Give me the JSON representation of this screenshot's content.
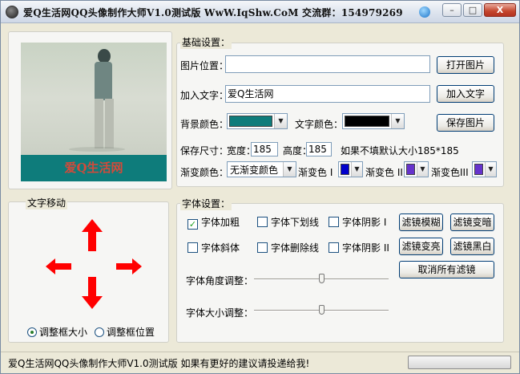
{
  "window": {
    "title": "爱Q生活网QQ头像制作大师V1.0测试版 WwW.IqShw.CoM  交流群：154979269",
    "min_label": "–",
    "max_label": "□",
    "close_label": "X"
  },
  "preview": {
    "caption": "爱Q生活网",
    "band_color": "#0e7c7b",
    "caption_color": "#d34a3a"
  },
  "text_move": {
    "title": "文字移动",
    "arrows": [
      "up",
      "left",
      "right",
      "down"
    ],
    "arrow_color": "#ff0000",
    "radio_resize": "调整框大小",
    "radio_position": "调整框位置",
    "selected": "调整框大小"
  },
  "basic": {
    "title": "基础设置：",
    "image_path_label": "图片位置：",
    "image_path_value": "",
    "open_button": "打开图片",
    "add_text_label": "加入文字：",
    "add_text_value": "爱Q生活网",
    "add_text_button": "加入文字",
    "bg_color_label": "背景颜色：",
    "bg_color": "#0e7c7b",
    "text_color_label": "文字颜色：",
    "text_color": "#000000",
    "save_button": "保存图片",
    "size_label": "保存尺寸：",
    "width_label": "宽度：",
    "width_value": "185",
    "height_label": "高度：",
    "height_value": "185",
    "size_hint": "如果不填默认大小185*185",
    "gradient_label": "渐变颜色：",
    "gradient_value": "无渐变颜色",
    "gradient1_label": "渐变色 I",
    "gradient1_color": "#0000cc",
    "gradient2_label": "渐变色 II",
    "gradient2_color": "#6633cc",
    "gradient3_label": "渐变色III",
    "gradient3_color": "#6633cc"
  },
  "font": {
    "title": "字体设置：",
    "bold": {
      "label": "字体加粗",
      "checked": true,
      "mark": "✓"
    },
    "underline": {
      "label": "字体下划线",
      "checked": false
    },
    "shadow1": {
      "label": "字体阴影 I",
      "checked": false
    },
    "italic": {
      "label": "字体斜体",
      "checked": false
    },
    "strike": {
      "label": "字体删除线",
      "checked": false
    },
    "shadow2": {
      "label": "字体阴影 II",
      "checked": false
    },
    "blur_button": "滤镜模糊",
    "darken_button": "滤镜变暗",
    "lighten_button": "滤镜变亮",
    "bw_button": "滤镜黑白",
    "cancel_filters_button": "取消所有滤镜",
    "angle_label": "字体角度调整：",
    "angle_level": 0.5,
    "size_label": "字体大小调整：",
    "size_level": 0.5
  },
  "status": {
    "text": "爱Q生活网QQ头像制作大师V1.0测试版   如果有更好的建议请投递给我!"
  }
}
